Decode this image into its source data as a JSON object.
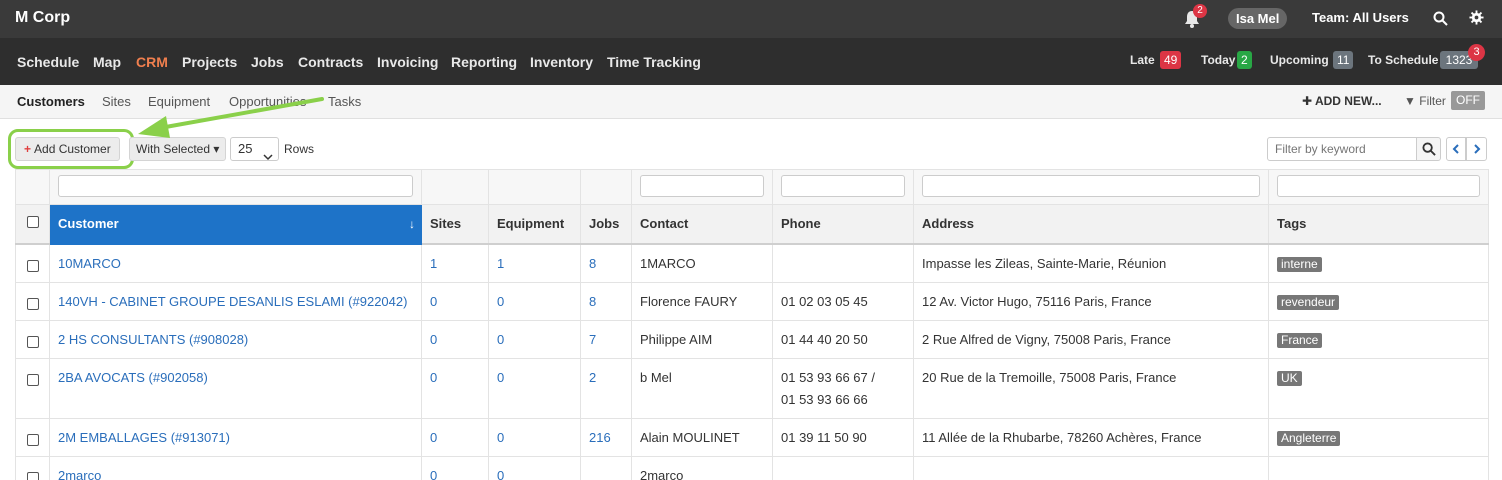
{
  "topbar": {
    "brand": "M Corp",
    "notification_count": "2",
    "user": "Isa Mel",
    "team": "Team: All Users"
  },
  "nav": {
    "items": [
      "Schedule",
      "Map",
      "CRM",
      "Projects",
      "Jobs",
      "Contracts",
      "Invoicing",
      "Reporting",
      "Inventory",
      "Time Tracking"
    ],
    "active": "CRM",
    "counts": {
      "late_label": "Late",
      "late": "49",
      "today_label": "Today",
      "today": "2",
      "upcoming_label": "Upcoming",
      "upcoming": "11",
      "to_schedule_label": "To Schedule",
      "to_schedule": "1323",
      "to_schedule_alert": "3"
    }
  },
  "subnav": {
    "items": [
      "Customers",
      "Sites",
      "Equipment",
      "Opportunities",
      "Tasks"
    ],
    "active": "Customers",
    "add_new": "ADD NEW...",
    "filter": "Filter",
    "filter_state": "OFF"
  },
  "toolbar": {
    "add_customer": "Add Customer",
    "with_selected": "With Selected",
    "rows_value": "25",
    "rows_label": "Rows",
    "keyword_placeholder": "Filter by keyword"
  },
  "table": {
    "columns": [
      "Customer",
      "Sites",
      "Equipment",
      "Jobs",
      "Contact",
      "Phone",
      "Address",
      "Tags"
    ],
    "rows": [
      {
        "customer": "10MARCO",
        "sites": "1",
        "equipment": "1",
        "jobs": "8",
        "contact": "1MARCO",
        "phone": "",
        "phone2": "",
        "address": "Impasse les Zileas, Sainte-Marie, Réunion",
        "tag": "interne"
      },
      {
        "customer": "140VH - CABINET GROUPE DESANLIS ESLAMI (#922042)",
        "sites": "0",
        "equipment": "0",
        "jobs": "8",
        "contact": "Florence FAURY",
        "phone": "01 02 03 05 45",
        "phone2": "",
        "address": "12 Av. Victor Hugo, 75116 Paris, France",
        "tag": "revendeur"
      },
      {
        "customer": "2 HS CONSULTANTS (#908028)",
        "sites": "0",
        "equipment": "0",
        "jobs": "7",
        "contact": "Philippe AIM",
        "phone": "01 44 40 20 50",
        "phone2": "",
        "address": "2 Rue Alfred de Vigny, 75008 Paris, France",
        "tag": "France"
      },
      {
        "customer": "2BA AVOCATS (#902058)",
        "sites": "0",
        "equipment": "0",
        "jobs": "2",
        "contact": "b Mel",
        "phone": "01 53 93 66 67 /",
        "phone2": "01 53 93 66 66",
        "address": "20 Rue de la Tremoille, 75008 Paris, France",
        "tag": "UK"
      },
      {
        "customer": "2M EMBALLAGES (#913071)",
        "sites": "0",
        "equipment": "0",
        "jobs": "216",
        "contact": "Alain MOULINET",
        "phone": "01 39 11 50 90",
        "phone2": "",
        "address": "11 Allée de la Rhubarbe, 78260 Achères, France",
        "tag": "Angleterre"
      },
      {
        "customer": "2marco",
        "sites": "0",
        "equipment": "0",
        "jobs": "",
        "contact": "2marco",
        "phone": "",
        "phone2": "",
        "address": "",
        "tag": ""
      }
    ]
  }
}
